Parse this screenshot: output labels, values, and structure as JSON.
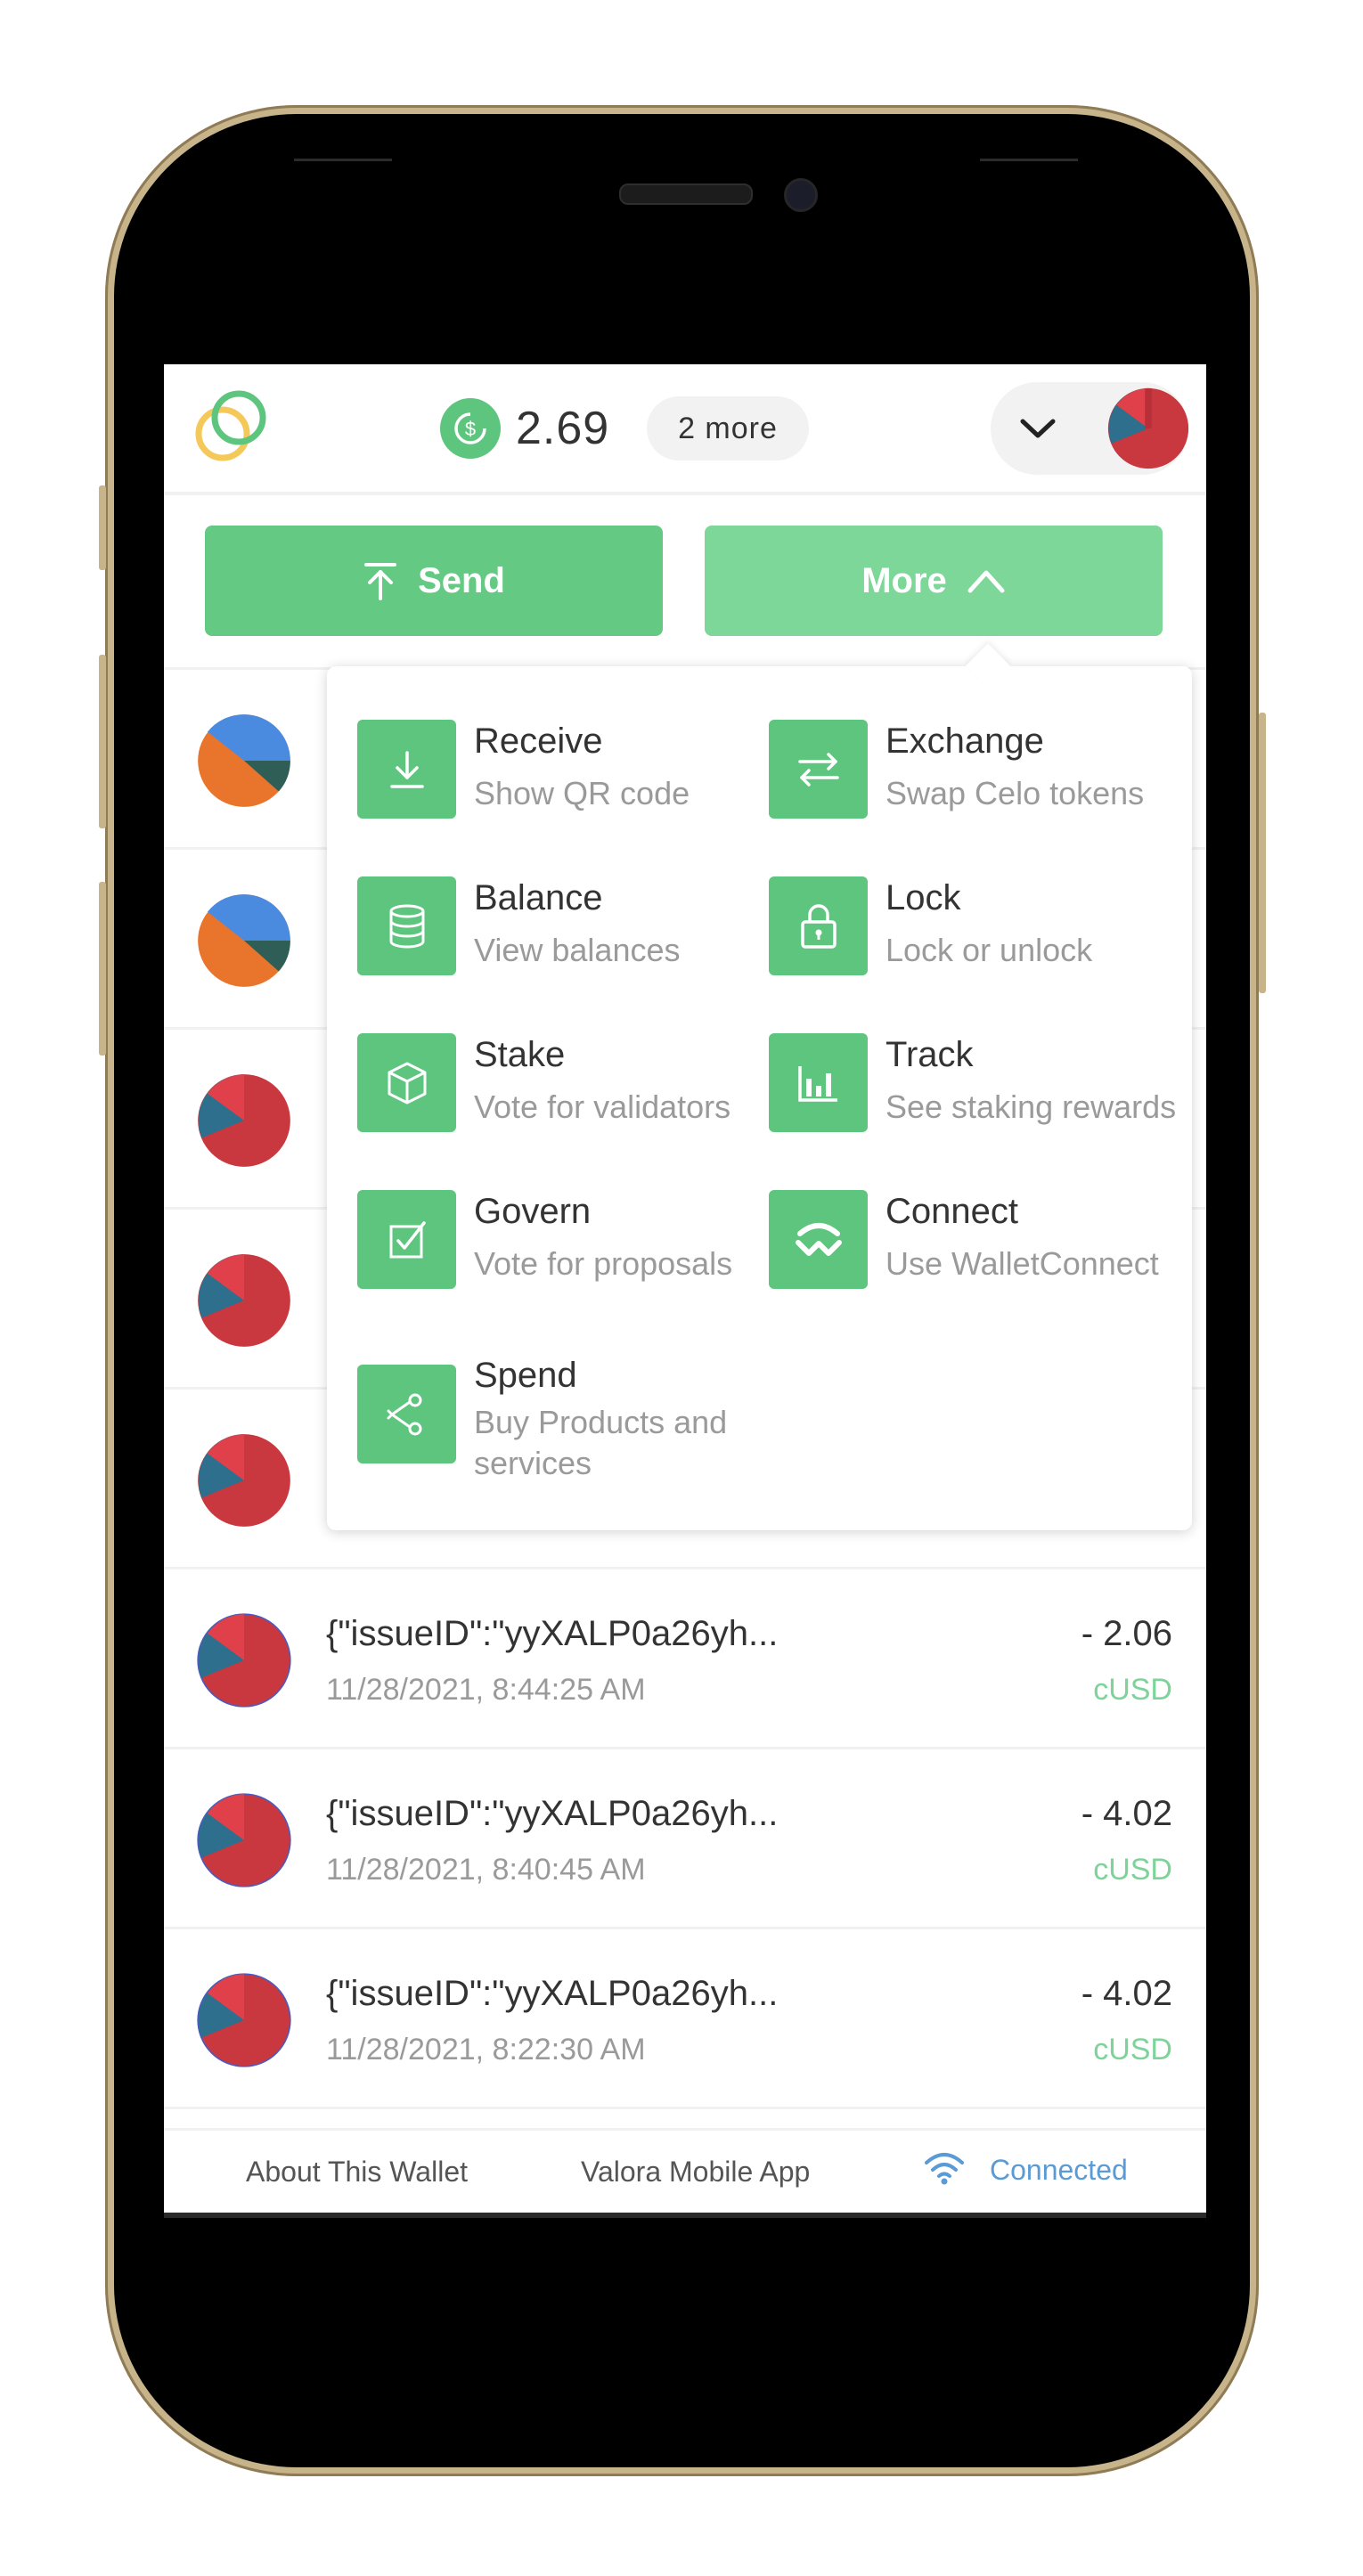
{
  "header": {
    "balance": "2.69",
    "more_tokens": "2 more",
    "coin_symbol": "$"
  },
  "actions": {
    "send_label": "Send",
    "more_label": "More"
  },
  "menu": [
    {
      "title": "Receive",
      "subtitle": "Show QR code",
      "icon": "download-icon"
    },
    {
      "title": "Exchange",
      "subtitle": "Swap Celo tokens",
      "icon": "swap-arrows-icon"
    },
    {
      "title": "Balance",
      "subtitle": "View balances",
      "icon": "database-icon"
    },
    {
      "title": "Lock",
      "subtitle": "Lock or unlock",
      "icon": "lock-icon"
    },
    {
      "title": "Stake",
      "subtitle": "Vote for validators",
      "icon": "cube-icon"
    },
    {
      "title": "Track",
      "subtitle": "See staking rewards",
      "icon": "bar-chart-icon"
    },
    {
      "title": "Govern",
      "subtitle": "Vote for proposals",
      "icon": "checkbox-icon"
    },
    {
      "title": "Connect",
      "subtitle": "Use WalletConnect",
      "icon": "walletconnect-icon"
    },
    {
      "title": "Spend",
      "subtitle": "Buy Products and services",
      "icon": "share-nodes-icon"
    }
  ],
  "transactions": [
    {
      "comment": "{\"issueID\":\"yyXALP0a26yh...",
      "time": "11/28/2021, 8:44:25 AM",
      "amount": "- 2.06",
      "currency": "cUSD"
    },
    {
      "comment": "{\"issueID\":\"yyXALP0a26yh...",
      "time": "11/28/2021, 8:40:45 AM",
      "amount": "- 4.02",
      "currency": "cUSD"
    },
    {
      "comment": "{\"issueID\":\"yyXALP0a26yh...",
      "time": "11/28/2021, 8:22:30 AM",
      "amount": "- 4.02",
      "currency": "cUSD"
    }
  ],
  "footer": {
    "about": "About This Wallet",
    "app": "Valora Mobile App",
    "status": "Connected"
  },
  "colors": {
    "primary_green": "#64c983",
    "light_green": "#7cd798",
    "currency_green": "#7ed39a",
    "status_blue": "#5b9bd5"
  }
}
